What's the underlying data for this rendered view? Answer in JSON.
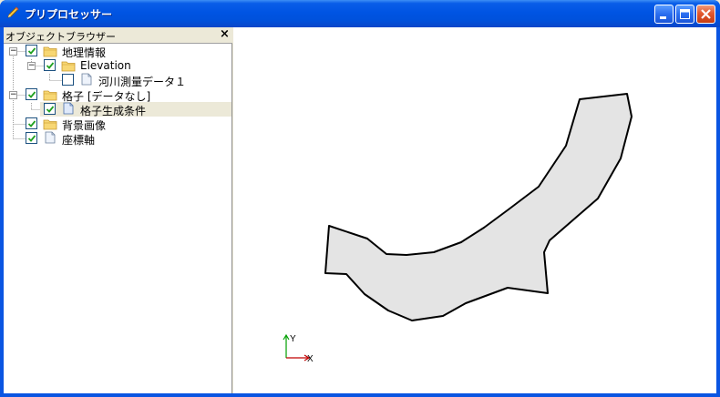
{
  "window": {
    "title": "プリプロセッサー",
    "accent_color": "#0054e3",
    "controls": [
      "minimize-icon",
      "maximize-icon",
      "close-icon"
    ]
  },
  "object_browser": {
    "title": "オブジェクトブラウザー",
    "close_glyph": "×",
    "tree": [
      {
        "label": "地理情報",
        "icon": "folder-icon",
        "checked": true,
        "expanded": true
      },
      {
        "label": "Elevation",
        "icon": "folder-icon",
        "checked": true,
        "expanded": true
      },
      {
        "label": "河川測量データ１",
        "icon": "doc-icon",
        "checked": false
      },
      {
        "label": "格子 [データなし]",
        "icon": "folder-icon",
        "checked": true,
        "expanded": true
      },
      {
        "label": "格子生成条件",
        "icon": "doc-icon",
        "checked": true,
        "selected": true
      },
      {
        "label": "背景画像",
        "icon": "folder-icon",
        "checked": true
      },
      {
        "label": "座標軸",
        "icon": "doc-icon",
        "checked": true
      }
    ]
  },
  "canvas": {
    "background": "#ffffff",
    "polygon_fill": "#e4e4e4",
    "polygon_stroke": "#000000",
    "axis": {
      "y_label": "Y",
      "x_label": "X",
      "y_color": "#00a000",
      "x_color": "#c00000"
    }
  }
}
